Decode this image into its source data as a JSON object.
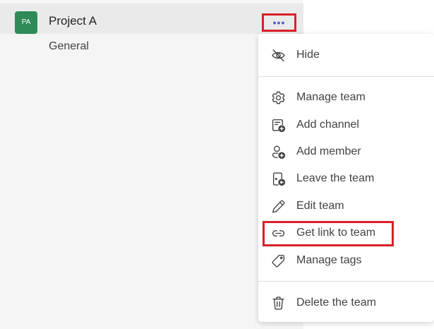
{
  "team": {
    "initials": "PA",
    "name": "Project A",
    "more_glyph": "•••",
    "avatar_color": "#2e8b57",
    "channel": "General"
  },
  "menu": {
    "hide": {
      "label": "Hide",
      "icon": "hide-icon"
    },
    "items": [
      {
        "label": "Manage team",
        "icon": "gear-icon"
      },
      {
        "label": "Add channel",
        "icon": "add-channel-icon"
      },
      {
        "label": "Add member",
        "icon": "add-member-icon"
      },
      {
        "label": "Leave the team",
        "icon": "leave-icon"
      },
      {
        "label": "Edit team",
        "icon": "pencil-icon"
      },
      {
        "label": "Get link to team",
        "icon": "link-icon"
      },
      {
        "label": "Manage tags",
        "icon": "tag-icon"
      }
    ],
    "delete": {
      "label": "Delete the team",
      "icon": "trash-icon"
    }
  },
  "colors": {
    "highlight": "#d92027",
    "accent": "#5b5fc7"
  }
}
